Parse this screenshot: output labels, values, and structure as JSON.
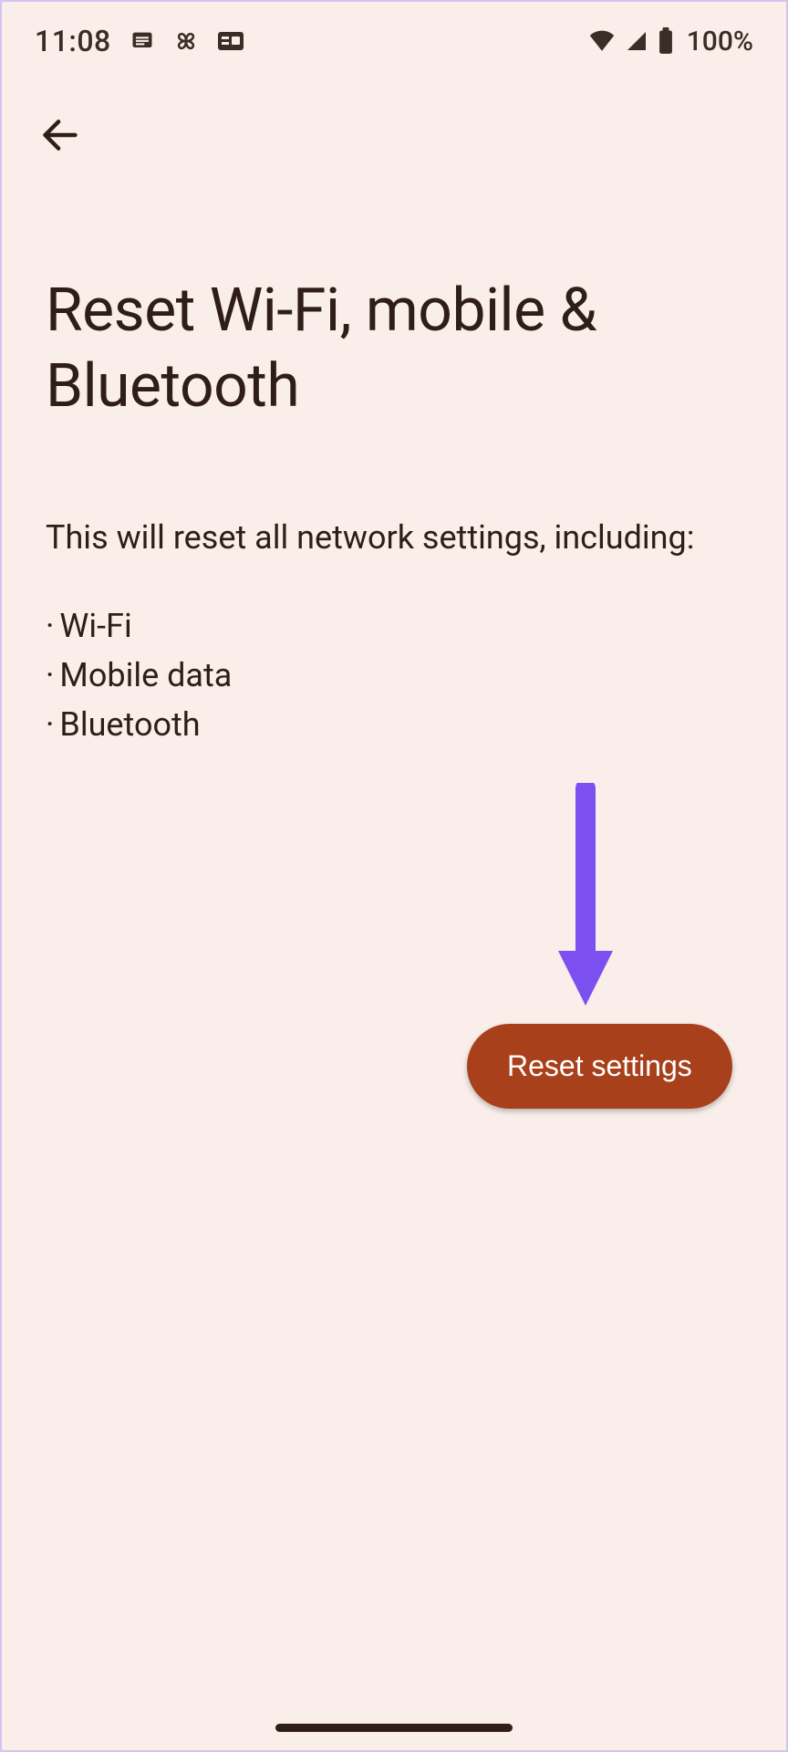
{
  "statusbar": {
    "time": "11:08",
    "battery_text": "100%"
  },
  "page": {
    "title": "Reset Wi-Fi, mobile & Bluetooth",
    "description": "This will reset all network settings, including:",
    "bullets": [
      "Wi-Fi",
      "Mobile data",
      "Bluetooth"
    ],
    "reset_button_label": "Reset settings"
  }
}
